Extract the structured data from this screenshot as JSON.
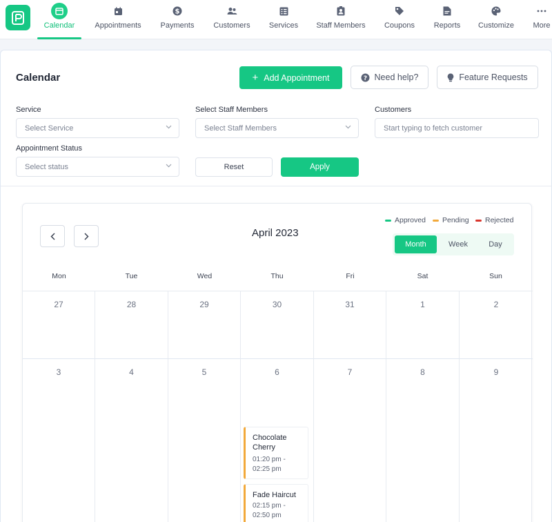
{
  "nav": {
    "items": [
      {
        "label": "Calendar",
        "icon": "calendar-icon",
        "active": true
      },
      {
        "label": "Appointments",
        "icon": "appointments-icon"
      },
      {
        "label": "Payments",
        "icon": "dollar-icon"
      },
      {
        "label": "Customers",
        "icon": "users-icon"
      },
      {
        "label": "Services",
        "icon": "services-icon"
      },
      {
        "label": "Staff Members",
        "icon": "badge-icon"
      },
      {
        "label": "Coupons",
        "icon": "tag-icon"
      },
      {
        "label": "Reports",
        "icon": "document-icon"
      },
      {
        "label": "Customize",
        "icon": "palette-icon"
      },
      {
        "label": "More",
        "icon": "more-icon"
      }
    ]
  },
  "header": {
    "title": "Calendar",
    "add_label": "Add Appointment",
    "help_label": "Need help?",
    "feature_label": "Feature Requests"
  },
  "filters": {
    "service_label": "Service",
    "service_placeholder": "Select Service",
    "staff_label": "Select Staff Members",
    "staff_placeholder": "Select Staff Members",
    "customers_label": "Customers",
    "customers_placeholder": "Start typing to fetch customer",
    "status_label": "Appointment Status",
    "status_placeholder": "Select status",
    "reset_label": "Reset",
    "apply_label": "Apply"
  },
  "calendar": {
    "month_title": "April 2023",
    "legend": [
      {
        "label": "Approved",
        "color": "#16c784"
      },
      {
        "label": "Pending",
        "color": "#f2a93b"
      },
      {
        "label": "Rejected",
        "color": "#d9342b"
      }
    ],
    "views": [
      "Month",
      "Week",
      "Day"
    ],
    "active_view": "Month",
    "weekdays": [
      "Mon",
      "Tue",
      "Wed",
      "Thu",
      "Fri",
      "Sat",
      "Sun"
    ],
    "weeks": [
      [
        "27",
        "28",
        "29",
        "30",
        "31",
        "1",
        "2"
      ],
      [
        "3",
        "4",
        "5",
        "6",
        "7",
        "8",
        "9"
      ]
    ],
    "events": [
      {
        "title_line1": "Chocolate",
        "title_line2": "Cherry",
        "time_line1": "01:20 pm -",
        "time_line2": "02:25 pm",
        "status": "pending"
      },
      {
        "title_line1": "Fade Haircut",
        "time_line1": "02:15 pm -",
        "time_line2": "02:50 pm",
        "status": "pending"
      }
    ]
  },
  "colors": {
    "accent": "#16c784",
    "pending": "#f2a93b",
    "rejected": "#d9342b"
  }
}
